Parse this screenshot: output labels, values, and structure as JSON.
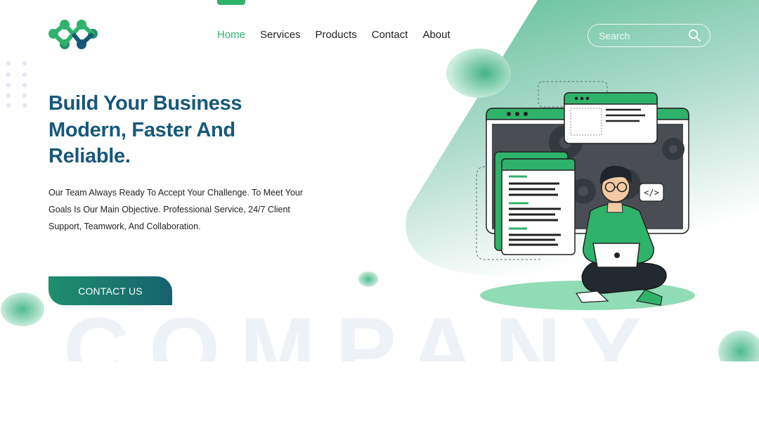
{
  "nav": {
    "items": [
      {
        "label": "Home",
        "active": true
      },
      {
        "label": "Services",
        "active": false
      },
      {
        "label": "Products",
        "active": false
      },
      {
        "label": "Contact",
        "active": false
      },
      {
        "label": "About",
        "active": false
      }
    ]
  },
  "search": {
    "placeholder": "Search"
  },
  "hero": {
    "headline_line1": "Build Your Business",
    "headline_line2": "Modern, Faster And",
    "headline_line3": "Reliable.",
    "description": "Our Team Always Ready To Accept Your Challenge. To Meet Your Goals Is Our Main Objective. Professional Service, 24/7 Client Support, Teamwork, And Collaboration.",
    "cta_label": "CONTACT US",
    "watermark": "COMPANY"
  },
  "illustration": {
    "code_tag": "</>"
  },
  "colors": {
    "accent_green": "#2fb36b",
    "headline_blue": "#17587a",
    "cta_start": "#1f8f6d",
    "cta_end": "#16626f",
    "panel_teal": "#5fbf9a"
  }
}
